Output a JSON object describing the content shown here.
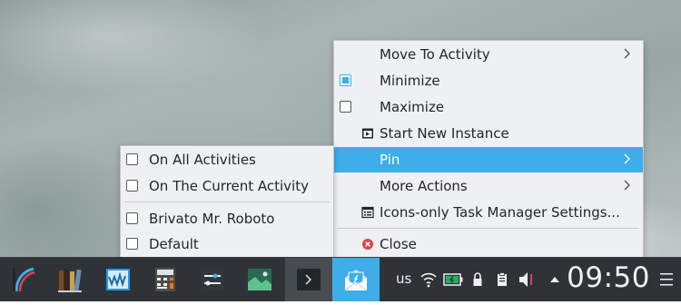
{
  "main_menu": {
    "items": [
      {
        "label": "Move To Activity",
        "submenu": true
      },
      {
        "label": "Minimize",
        "checked": true
      },
      {
        "label": "Maximize",
        "checked": false
      },
      {
        "label": "Start New Instance",
        "icon": "window-new-icon"
      },
      {
        "label": "Pin",
        "submenu": true,
        "highlighted": true
      },
      {
        "label": "More Actions",
        "submenu": true
      },
      {
        "label": "Icons-only Task Manager Settings...",
        "icon": "configure-icon"
      },
      {
        "label": "Close",
        "icon": "close-icon"
      }
    ]
  },
  "pin_submenu": {
    "items": [
      {
        "label": "On All Activities",
        "checked": false
      },
      {
        "label": "On The Current Activity",
        "checked": false
      },
      {
        "label": "Brivato Mr. Roboto",
        "checked": false
      },
      {
        "label": "Default",
        "checked": false
      }
    ]
  },
  "taskbar": {
    "apps": [
      {
        "name": "kde-app-launcher-icon"
      },
      {
        "name": "calibre-library-icon"
      },
      {
        "name": "system-monitor-icon"
      },
      {
        "name": "calculator-icon"
      },
      {
        "name": "settings-sliders-icon"
      },
      {
        "name": "image-viewer-icon"
      },
      {
        "name": "terminal-icon"
      },
      {
        "name": "mail-client-icon"
      }
    ],
    "keyboard_layout": "us",
    "clock": "09:50"
  },
  "colors": {
    "accent": "#3daee9",
    "menu_bg": "#eff0f1",
    "panel_bg": "#2f3337",
    "close_red": "#da4453"
  }
}
